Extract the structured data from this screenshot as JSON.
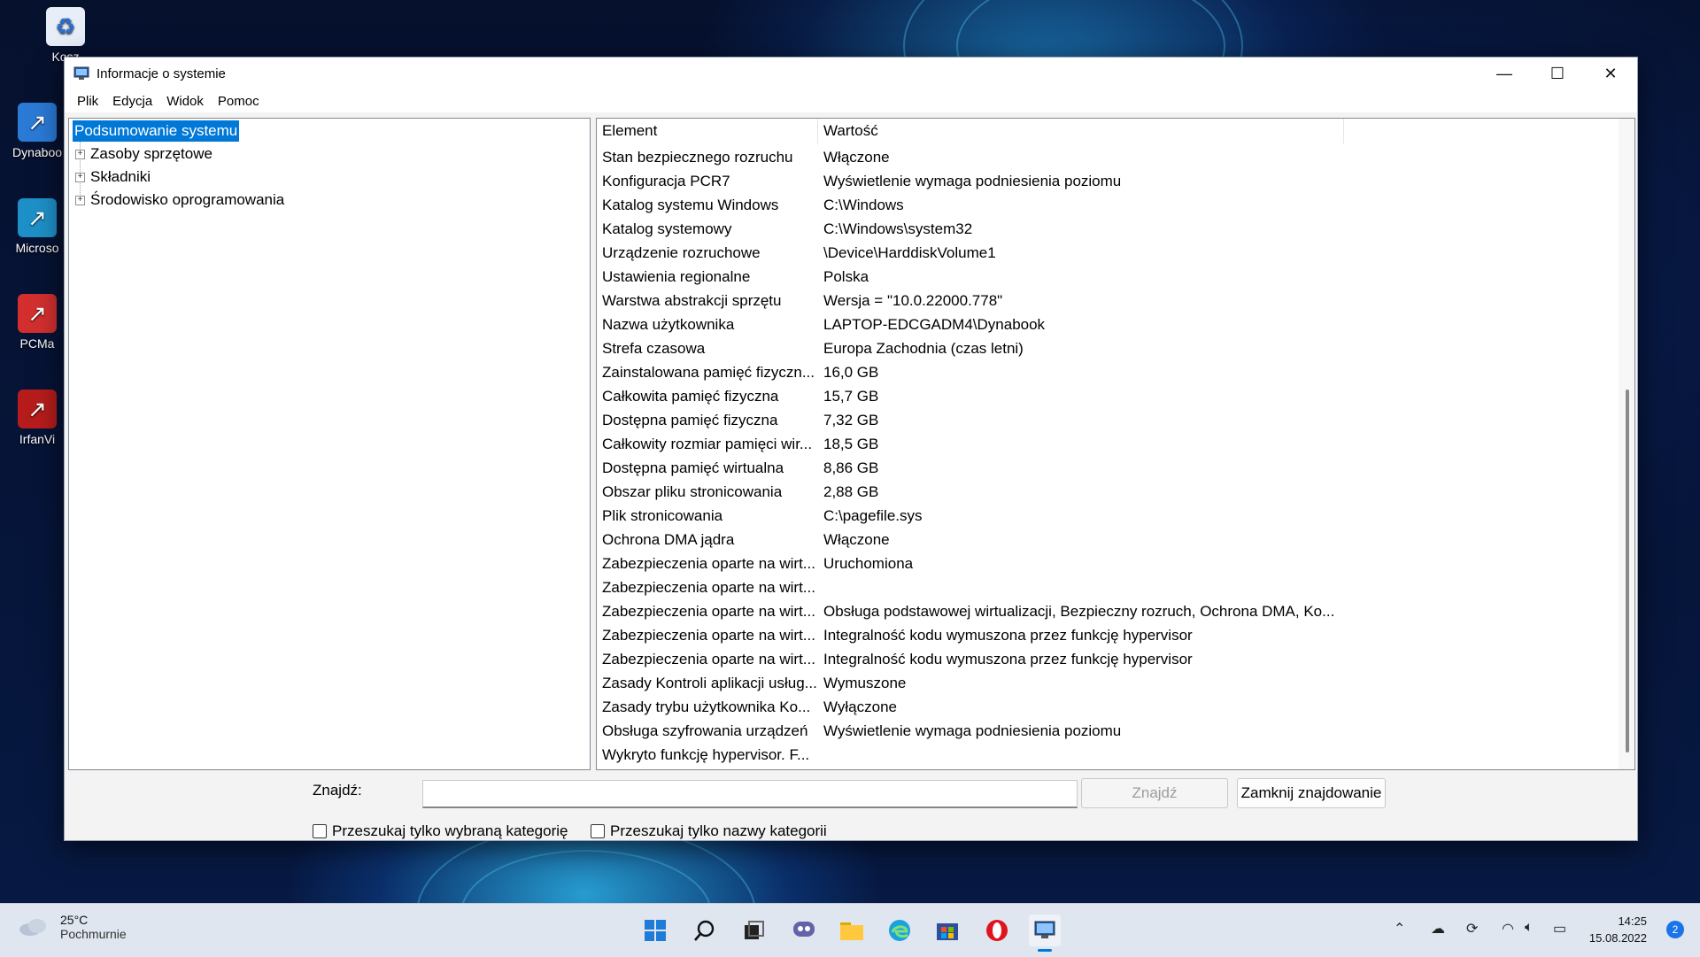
{
  "desktop": {
    "icons": [
      {
        "label": "Kosz",
        "icon": "recycle-bin-icon"
      },
      {
        "label": "Dynaboo",
        "icon": "shortcut-icon"
      },
      {
        "label": "Microso",
        "icon": "shortcut-icon"
      },
      {
        "label": "PCMa",
        "icon": "shortcut-icon"
      },
      {
        "label": "IrfanVi",
        "icon": "shortcut-icon"
      }
    ]
  },
  "window": {
    "title": "Informacje o systemie",
    "controls": {
      "minimize": "—",
      "maximize": "☐",
      "close": "✕"
    },
    "menu": [
      "Plik",
      "Edycja",
      "Widok",
      "Pomoc"
    ],
    "tree": [
      {
        "label": "Podsumowanie systemu",
        "selected": true,
        "expandable": false
      },
      {
        "label": "Zasoby sprzętowe",
        "expandable": true
      },
      {
        "label": "Składniki",
        "expandable": true
      },
      {
        "label": "Środowisko oprogramowania",
        "expandable": true
      }
    ],
    "table": {
      "columns": [
        "Element",
        "Wartość"
      ],
      "rows": [
        [
          "Stan bezpiecznego rozruchu",
          "Włączone"
        ],
        [
          "Konfiguracja PCR7",
          "Wyświetlenie wymaga podniesienia poziomu"
        ],
        [
          "Katalog systemu Windows",
          "C:\\Windows"
        ],
        [
          "Katalog systemowy",
          "C:\\Windows\\system32"
        ],
        [
          "Urządzenie rozruchowe",
          "\\Device\\HarddiskVolume1"
        ],
        [
          "Ustawienia regionalne",
          "Polska"
        ],
        [
          "Warstwa abstrakcji sprzętu",
          "Wersja = \"10.0.22000.778\""
        ],
        [
          "Nazwa użytkownika",
          "LAPTOP-EDCGADM4\\Dynabook"
        ],
        [
          "Strefa czasowa",
          "Europa Zachodnia (czas letni)"
        ],
        [
          "Zainstalowana pamięć fizyczn...",
          "16,0 GB"
        ],
        [
          "Całkowita pamięć fizyczna",
          "15,7 GB"
        ],
        [
          "Dostępna pamięć fizyczna",
          "7,32 GB"
        ],
        [
          "Całkowity rozmiar pamięci wir...",
          "18,5 GB"
        ],
        [
          "Dostępna pamięć wirtualna",
          "8,86 GB"
        ],
        [
          "Obszar pliku stronicowania",
          "2,88 GB"
        ],
        [
          "Plik stronicowania",
          "C:\\pagefile.sys"
        ],
        [
          "Ochrona DMA jądra",
          "Włączone"
        ],
        [
          "Zabezpieczenia oparte na wirt...",
          "Uruchomiona"
        ],
        [
          "Zabezpieczenia oparte na wirt...",
          ""
        ],
        [
          "Zabezpieczenia oparte na wirt...",
          "Obsługa podstawowej wirtualizacji, Bezpieczny rozruch, Ochrona DMA, Ko..."
        ],
        [
          "Zabezpieczenia oparte na wirt...",
          "Integralność kodu wymuszona przez funkcję hypervisor"
        ],
        [
          "Zabezpieczenia oparte na wirt...",
          "Integralność kodu wymuszona przez funkcję hypervisor"
        ],
        [
          "Zasady Kontroli aplikacji usług...",
          "Wymuszone"
        ],
        [
          "Zasady trybu użytkownika Ko...",
          "Wyłączone"
        ],
        [
          "Obsługa szyfrowania urządzeń",
          "Wyświetlenie wymaga podniesienia poziomu"
        ],
        [
          "Wykryto funkcję hypervisor. F...",
          ""
        ]
      ]
    },
    "find": {
      "label": "Znajdź:",
      "value": "",
      "find_button": "Znajdź",
      "close_button": "Zamknij znajdowanie",
      "checkbox1": "Przeszukaj tylko wybraną kategorię",
      "checkbox2": "Przeszukaj tylko nazwy kategorii"
    }
  },
  "taskbar": {
    "weather": {
      "temp": "25°C",
      "condition": "Pochmurnie"
    },
    "apps": [
      "start-icon",
      "search-icon",
      "task-view-icon",
      "chat-icon",
      "file-explorer-icon",
      "edge-icon",
      "store-icon",
      "opera-icon",
      "system-info-icon"
    ],
    "time": "14:25",
    "date": "15.08.2022",
    "notifications": "2",
    "accent": "#0078d7"
  }
}
